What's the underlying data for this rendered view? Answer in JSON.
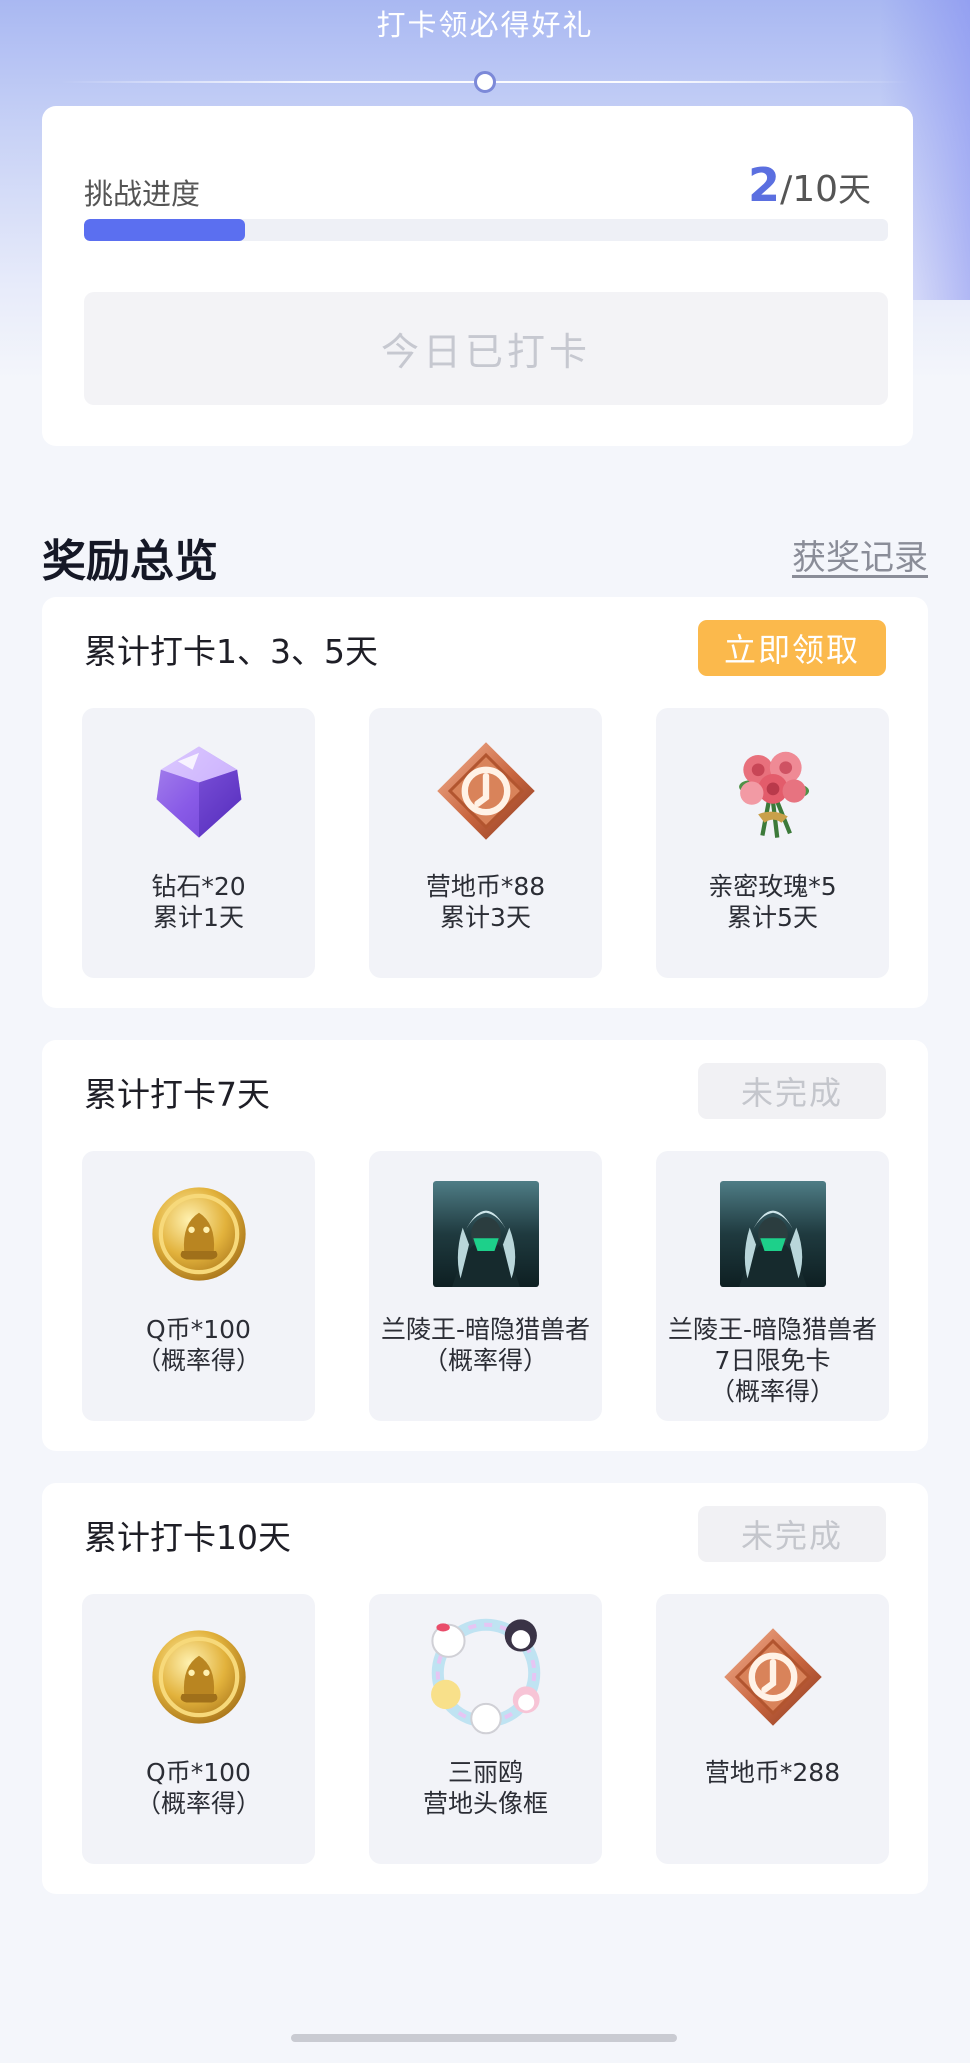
{
  "header": {
    "title": "打卡领必得好礼"
  },
  "progress": {
    "label": "挑战进度",
    "current": "2",
    "total": "/10",
    "unit": "天",
    "fraction": 0.2,
    "checkin_button": "今日已打卡"
  },
  "overview": {
    "title": "奖励总览",
    "records_link": "获奖记录"
  },
  "groups": [
    {
      "title": "累计打卡1、3、5天",
      "button": "立即领取",
      "button_state": "active",
      "rewards": [
        {
          "icon": "diamond-icon",
          "line1": "钻石*20",
          "line2": "累计1天",
          "line3": ""
        },
        {
          "icon": "camp-coin-icon",
          "line1": "营地币*88",
          "line2": "累计3天",
          "line3": ""
        },
        {
          "icon": "rose-icon",
          "line1": "亲密玫瑰*5",
          "line2": "累计5天",
          "line3": ""
        }
      ]
    },
    {
      "title": "累计打卡7天",
      "button": "未完成",
      "button_state": "disabled",
      "rewards": [
        {
          "icon": "q-coin-icon",
          "line1": "Q币*100",
          "line2": "（概率得）",
          "line3": ""
        },
        {
          "icon": "hero-skin-icon",
          "line1": "兰陵王-暗隐猎兽者",
          "line2": "（概率得）",
          "line3": ""
        },
        {
          "icon": "hero-skin-icon",
          "line1": "兰陵王-暗隐猎兽者",
          "line2": "7日限免卡",
          "line3": "（概率得）"
        }
      ]
    },
    {
      "title": "累计打卡10天",
      "button": "未完成",
      "button_state": "disabled",
      "rewards": [
        {
          "icon": "q-coin-icon",
          "line1": "Q币*100",
          "line2": "（概率得）",
          "line3": ""
        },
        {
          "icon": "avatar-frame-icon",
          "line1": "三丽鸥",
          "line2": "营地头像框",
          "line3": ""
        },
        {
          "icon": "camp-coin-icon",
          "line1": "营地币*288",
          "line2": "",
          "line3": ""
        }
      ]
    }
  ],
  "colors": {
    "accent": "#5b6ff0",
    "claim_button": "#fbb94c",
    "disabled_text": "#c4c6cc",
    "header_gradient_top": "#a9b8f2"
  }
}
